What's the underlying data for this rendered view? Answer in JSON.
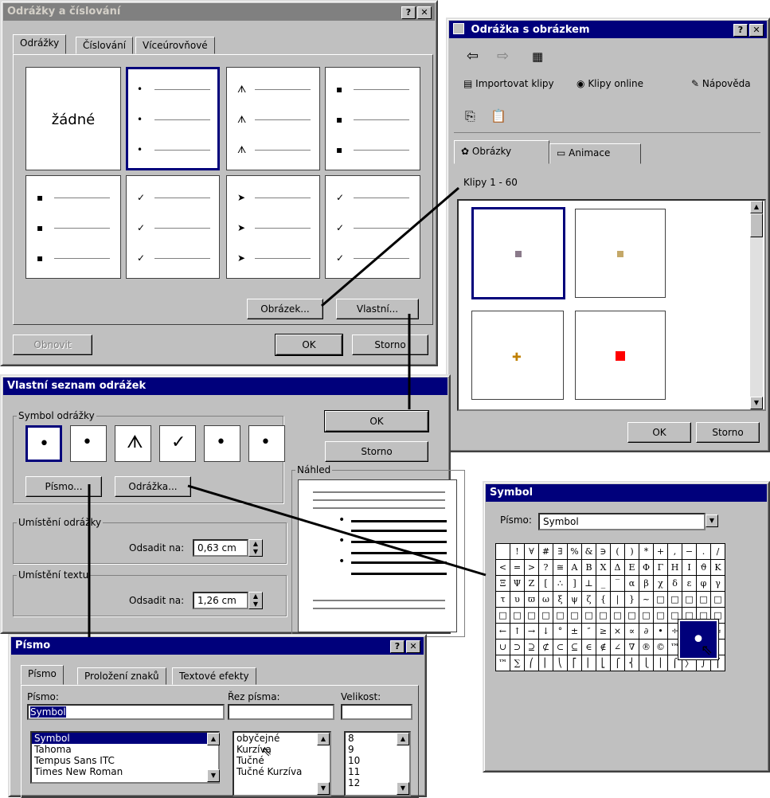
{
  "bullets_dialog": {
    "title": "Odrážky a číslování",
    "tabs": [
      "Odrážky",
      "Číslování",
      "Víceúrovňové"
    ],
    "none_label": "žádné",
    "picture_button": "Obrázek...",
    "custom_button": "Vlastní...",
    "reset_button": "Obnovit",
    "ok": "OK",
    "cancel": "Storno",
    "bullet_chars": [
      "•",
      "➤",
      "✓",
      "➤",
      "✓",
      "▪",
      "✓",
      "➤",
      "✓",
      "▪",
      "ᗑ",
      "▪"
    ]
  },
  "clip_dialog": {
    "title": "Odrážka s obrázkem",
    "import_clips": "Importovat klipy",
    "clips_online": "Klipy online",
    "help": "Nápověda",
    "tab_pictures": "Obrázky",
    "tab_animation": "Animace",
    "clips_range": "Klipy 1 - 60",
    "ok": "OK",
    "cancel": "Storno",
    "colors": {
      "thumb1": "#8a7a8a",
      "thumb2": "#c4a868",
      "thumb4": "#ff0000"
    }
  },
  "custom_dialog": {
    "title": "Vlastní seznam odrážek",
    "symbol_group": "Symbol odrážky",
    "symbols": [
      "•",
      "•",
      "ᗑ",
      "✓",
      "•",
      "•"
    ],
    "font_button": "Písmo...",
    "bullet_button": "Odrážka...",
    "ok": "OK",
    "cancel": "Storno",
    "preview": "Náhled",
    "bullet_position": "Umístění odrážky",
    "indent_at": "Odsadit na:",
    "bullet_indent_value": "0,63 cm",
    "text_position": "Umístění textu",
    "text_indent_at": "Odsadit na:",
    "text_indent_value": "1,26 cm"
  },
  "symbol_dialog": {
    "title": "Symbol",
    "font_label": "Písmo:",
    "font_value": "Symbol",
    "rows": [
      [
        " ",
        "!",
        "∀",
        "#",
        "∃",
        "%",
        "&",
        "∋",
        "(",
        ")",
        "*",
        "+",
        ",",
        "−",
        ".",
        "/"
      ],
      [
        "<",
        "=",
        ">",
        "?",
        "≅",
        "Α",
        "Β",
        "Χ",
        "Δ",
        "Ε",
        "Φ",
        "Γ",
        "Η",
        "Ι",
        "ϑ",
        "Κ"
      ],
      [
        "Ξ",
        "Ψ",
        "Ζ",
        "[",
        "∴",
        "]",
        "⊥",
        "_",
        "‾",
        "α",
        "β",
        "χ",
        "δ",
        "ε",
        "φ",
        "γ"
      ],
      [
        "τ",
        "υ",
        "ϖ",
        "ω",
        "ξ",
        "ψ",
        "ζ",
        "{",
        "|",
        "}",
        "~",
        "□",
        "□",
        "□",
        "□",
        "□"
      ],
      [
        "□",
        "□",
        "□",
        "□",
        "□",
        "□",
        "□",
        "□",
        "□",
        "□",
        "□",
        "□",
        "□",
        "□",
        "□",
        "□"
      ],
      [
        "←",
        "↑",
        "→",
        "↓",
        "°",
        "±",
        "″",
        "≥",
        "×",
        "∝",
        "∂",
        "•",
        "÷",
        "≠",
        "≡",
        "≈"
      ],
      [
        "∪",
        "⊃",
        "⊇",
        "⊄",
        "⊂",
        "⊆",
        "∈",
        "∉",
        "∠",
        "∇",
        "®",
        "©",
        "™",
        "∏",
        "√",
        "⋅"
      ],
      [
        "™",
        "∑",
        "⎛",
        "⎜",
        "⎝",
        "⎡",
        "⎢",
        "⎣",
        "⎧",
        "⎨",
        "⎩",
        "⎪",
        "⌠",
        "〉",
        "∫",
        "⌠"
      ]
    ],
    "zoom_char": "•"
  },
  "font_dialog": {
    "title": "Písmo",
    "tabs": [
      "Písmo",
      "Proložení znaků",
      "Textové efekty"
    ],
    "font_label": "Písmo:",
    "font_value": "Symbol",
    "fonts": [
      "Symbol",
      "Tahoma",
      "Tempus Sans ITC",
      "Times New Roman"
    ],
    "style_label": "Řez písma:",
    "style_value": "",
    "styles": [
      "obyčejné",
      "Kurzíva",
      "Tučné",
      "Tučné Kurzíva"
    ],
    "size_label": "Velikost:",
    "size_value": "",
    "sizes": [
      "8",
      "9",
      "10",
      "11",
      "12"
    ]
  }
}
